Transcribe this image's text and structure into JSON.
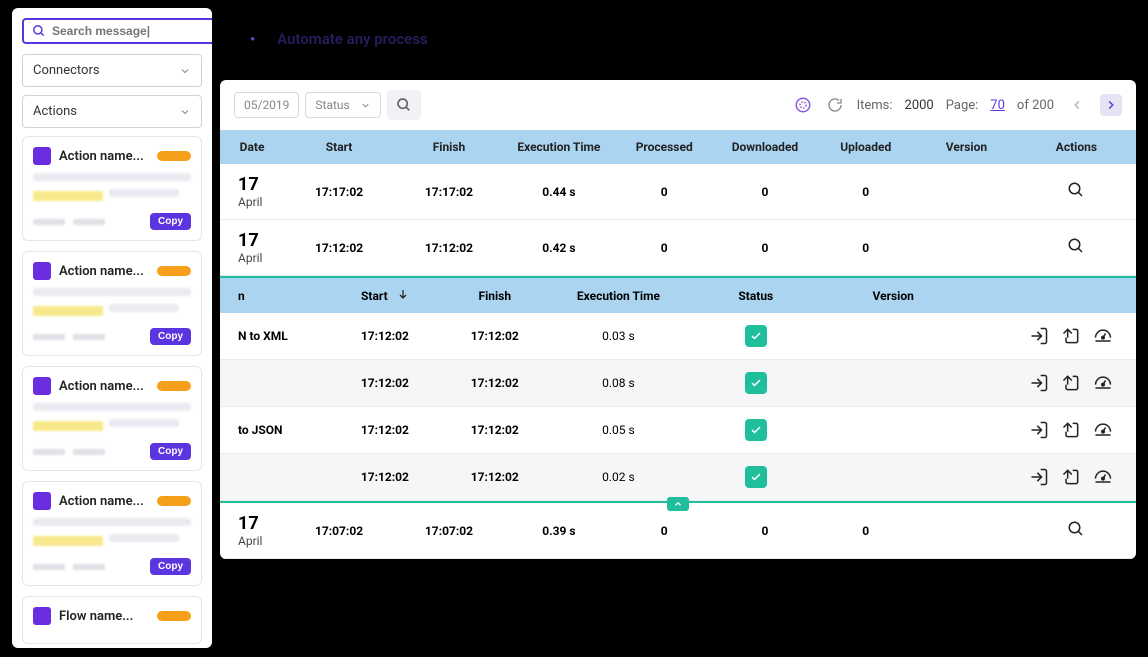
{
  "banner": {
    "text": "Automate any process"
  },
  "sidebar": {
    "search_placeholder": "Search message|",
    "connectors_label": "Connectors",
    "actions_label": "Actions",
    "copy_label": "Copy",
    "cards": [
      {
        "title": "Action name..."
      },
      {
        "title": "Action name..."
      },
      {
        "title": "Action name..."
      },
      {
        "title": "Action name..."
      },
      {
        "title": "Flow name..."
      }
    ]
  },
  "toolbar": {
    "date_chip": "05/2019",
    "status_label": "Status",
    "items_label": "Items:",
    "items_value": "2000",
    "page_label": "Page:",
    "page_current": "70",
    "page_of": "of 200"
  },
  "outer_table": {
    "columns": [
      "Date",
      "Start",
      "Finish",
      "Execution Time",
      "Processed",
      "Downloaded",
      "Uploaded",
      "Version",
      "Actions"
    ],
    "rows": [
      {
        "day": "17",
        "month": "April",
        "start": "17:17:02",
        "finish": "17:17:02",
        "exec": "0.44 s",
        "processed": "0",
        "downloaded": "0",
        "uploaded": "0",
        "version": ""
      },
      {
        "day": "17",
        "month": "April",
        "start": "17:12:02",
        "finish": "17:12:02",
        "exec": "0.42 s",
        "processed": "0",
        "downloaded": "0",
        "uploaded": "0",
        "version": ""
      }
    ],
    "bottom_row": {
      "day": "17",
      "month": "April",
      "start": "17:07:02",
      "finish": "17:07:02",
      "exec": "0.39 s",
      "processed": "0",
      "downloaded": "0",
      "uploaded": "0",
      "version": ""
    }
  },
  "inner_table": {
    "columns": [
      "n",
      "Start",
      "Finish",
      "Execution Time",
      "Status",
      "Version",
      ""
    ],
    "rows": [
      {
        "name": "N to XML",
        "start": "17:12:02",
        "finish": "17:12:02",
        "exec": "0.03 s"
      },
      {
        "name": "",
        "start": "17:12:02",
        "finish": "17:12:02",
        "exec": "0.08 s"
      },
      {
        "name": "to JSON",
        "start": "17:12:02",
        "finish": "17:12:02",
        "exec": "0.05 s"
      },
      {
        "name": "",
        "start": "17:12:02",
        "finish": "17:12:02",
        "exec": "0.02 s"
      }
    ]
  }
}
